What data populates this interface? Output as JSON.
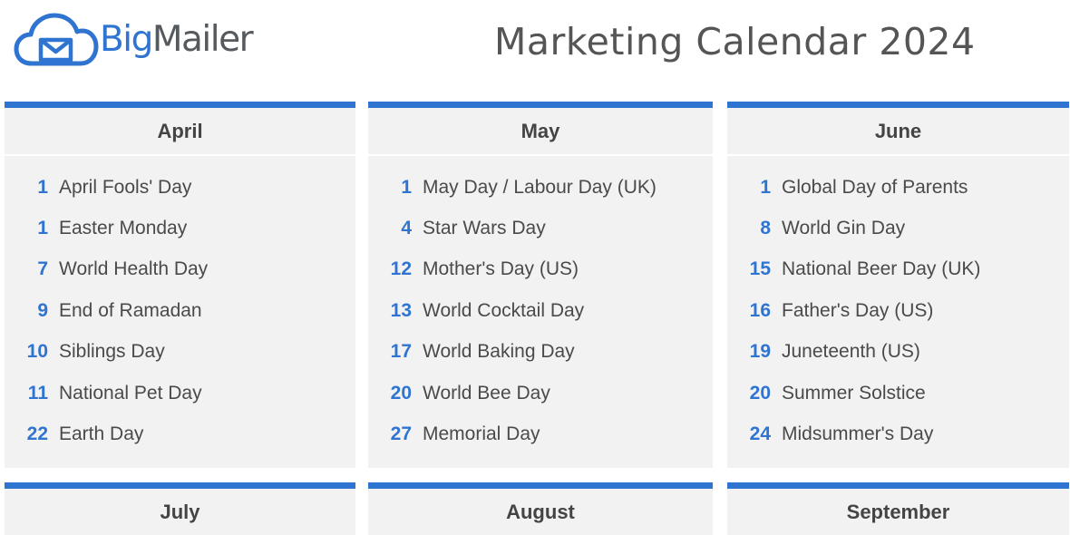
{
  "brand": {
    "name_part1": "Big",
    "name_part2": "Mailer",
    "accent_color": "#2f74d0",
    "icon": "cloud-envelope-icon"
  },
  "title": "Marketing Calendar 2024",
  "months": [
    {
      "name": "April",
      "events": [
        {
          "day": "1",
          "name": "April Fools' Day"
        },
        {
          "day": "1",
          "name": "Easter Monday"
        },
        {
          "day": "7",
          "name": "World Health Day"
        },
        {
          "day": "9",
          "name": "End of Ramadan"
        },
        {
          "day": "10",
          "name": "Siblings Day"
        },
        {
          "day": "11",
          "name": "National Pet Day"
        },
        {
          "day": "22",
          "name": "Earth Day"
        }
      ]
    },
    {
      "name": "May",
      "events": [
        {
          "day": "1",
          "name": "May Day / Labour Day (UK)"
        },
        {
          "day": "4",
          "name": "Star Wars Day"
        },
        {
          "day": "12",
          "name": "Mother's Day (US)"
        },
        {
          "day": "13",
          "name": "World Cocktail Day"
        },
        {
          "day": "17",
          "name": "World Baking Day"
        },
        {
          "day": "20",
          "name": "World Bee Day"
        },
        {
          "day": "27",
          "name": "Memorial Day"
        }
      ]
    },
    {
      "name": "June",
      "events": [
        {
          "day": "1",
          "name": "Global Day of Parents"
        },
        {
          "day": "8",
          "name": "World Gin Day"
        },
        {
          "day": "15",
          "name": "National Beer Day (UK)"
        },
        {
          "day": "16",
          "name": "Father's Day (US)"
        },
        {
          "day": "19",
          "name": "Juneteenth (US)"
        },
        {
          "day": "20",
          "name": "Summer Solstice"
        },
        {
          "day": "24",
          "name": "Midsummer's Day"
        }
      ]
    },
    {
      "name": "July",
      "events": []
    },
    {
      "name": "August",
      "events": []
    },
    {
      "name": "September",
      "events": []
    }
  ]
}
